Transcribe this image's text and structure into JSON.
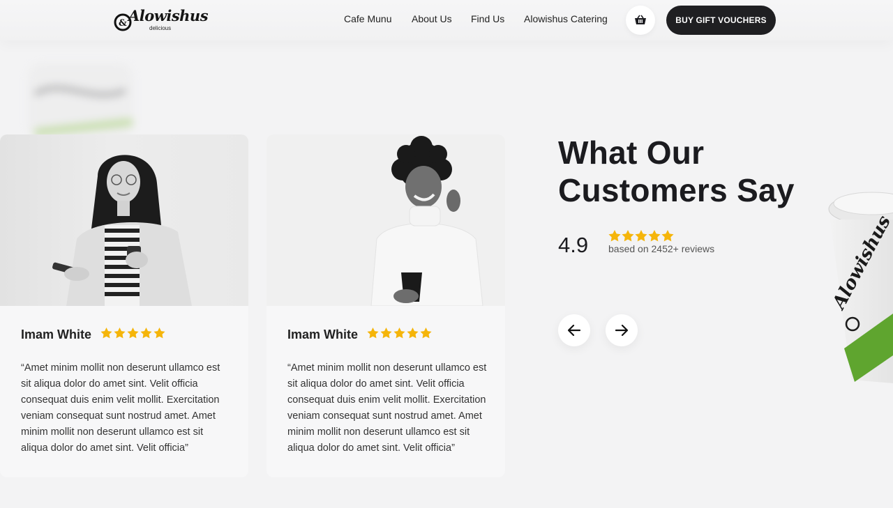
{
  "header": {
    "logo_text": "Alowishus",
    "logo_sub": "delicious",
    "nav": [
      {
        "label": "Cafe Munu"
      },
      {
        "label": "About Us"
      },
      {
        "label": "Find Us"
      },
      {
        "label": "Alowishus Catering"
      }
    ],
    "cart_icon": "basket-icon",
    "gift_button": "BUY GIFT VOUCHERS"
  },
  "section": {
    "title_line1": "What Our",
    "title_line2": "Customers Say",
    "rating_value": "4.9",
    "rating_stars": 5,
    "rating_text": "based on 2452+ reviews",
    "prev_icon": "arrow-left-icon",
    "next_icon": "arrow-right-icon"
  },
  "testimonials": [
    {
      "name": "Imam White",
      "stars": 5,
      "quote": "“Amet minim mollit non deserunt ullamco est sit aliqua dolor do amet sint. Velit officia consequat duis enim velit mollit. Exercitation veniam consequat sunt nostrud amet. Amet minim mollit non deserunt ullamco est sit aliqua dolor do amet sint. Velit officia”"
    },
    {
      "name": "Imam White",
      "stars": 5,
      "quote": "“Amet minim mollit non deserunt ullamco est sit aliqua dolor do amet sint. Velit officia consequat duis enim velit mollit. Exercitation veniam consequat sunt nostrud amet. Amet minim mollit non deserunt ullamco est sit aliqua dolor do amet sint. Velit officia”"
    }
  ],
  "colors": {
    "star": "#f5b50a",
    "dark_button": "#1f1f22",
    "background": "#f3f3f4",
    "cup_green": "#5fa52f"
  }
}
